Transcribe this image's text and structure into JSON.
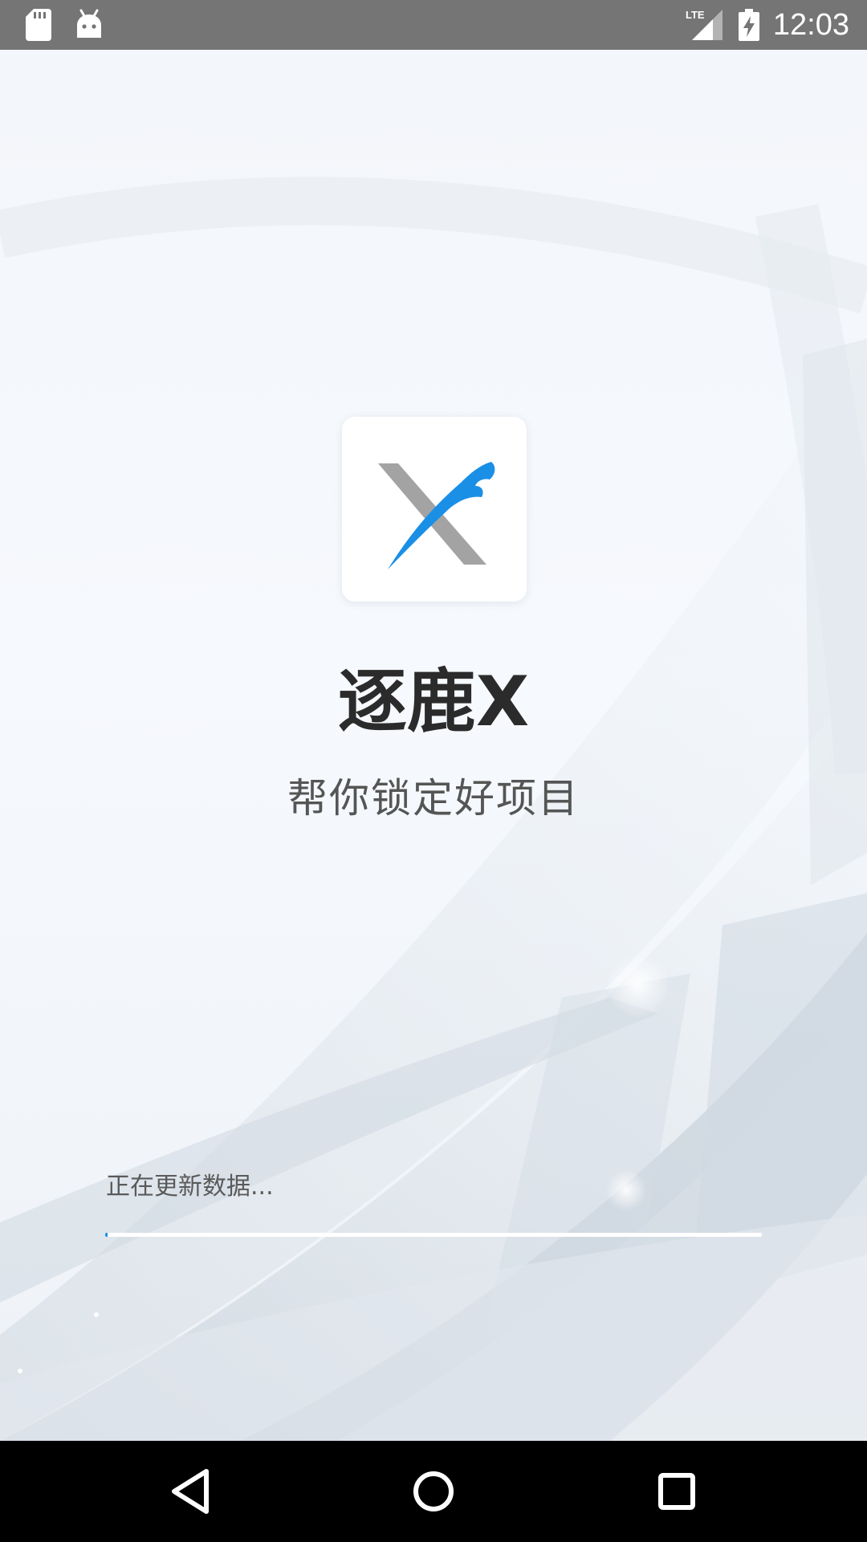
{
  "status_bar": {
    "time": "12:03",
    "network_label": "LTE",
    "icons": [
      "sd-card-icon",
      "android-debug-icon",
      "lte-signal-icon",
      "battery-charging-icon"
    ],
    "color": "#757575"
  },
  "splash": {
    "app_name": "逐鹿X",
    "slogan": "帮你锁定好项目",
    "logo_icon": "zhulu-x-logo-icon",
    "logo_colors": {
      "gray": "#a3a3a3",
      "blue": "#1a8fe6"
    }
  },
  "loading": {
    "status_text": "正在更新数据...",
    "progress_fraction": 0.003,
    "progress_color": "#1a8fe6"
  },
  "nav_bar": {
    "buttons": [
      "back-icon",
      "home-icon",
      "recents-icon"
    ]
  }
}
